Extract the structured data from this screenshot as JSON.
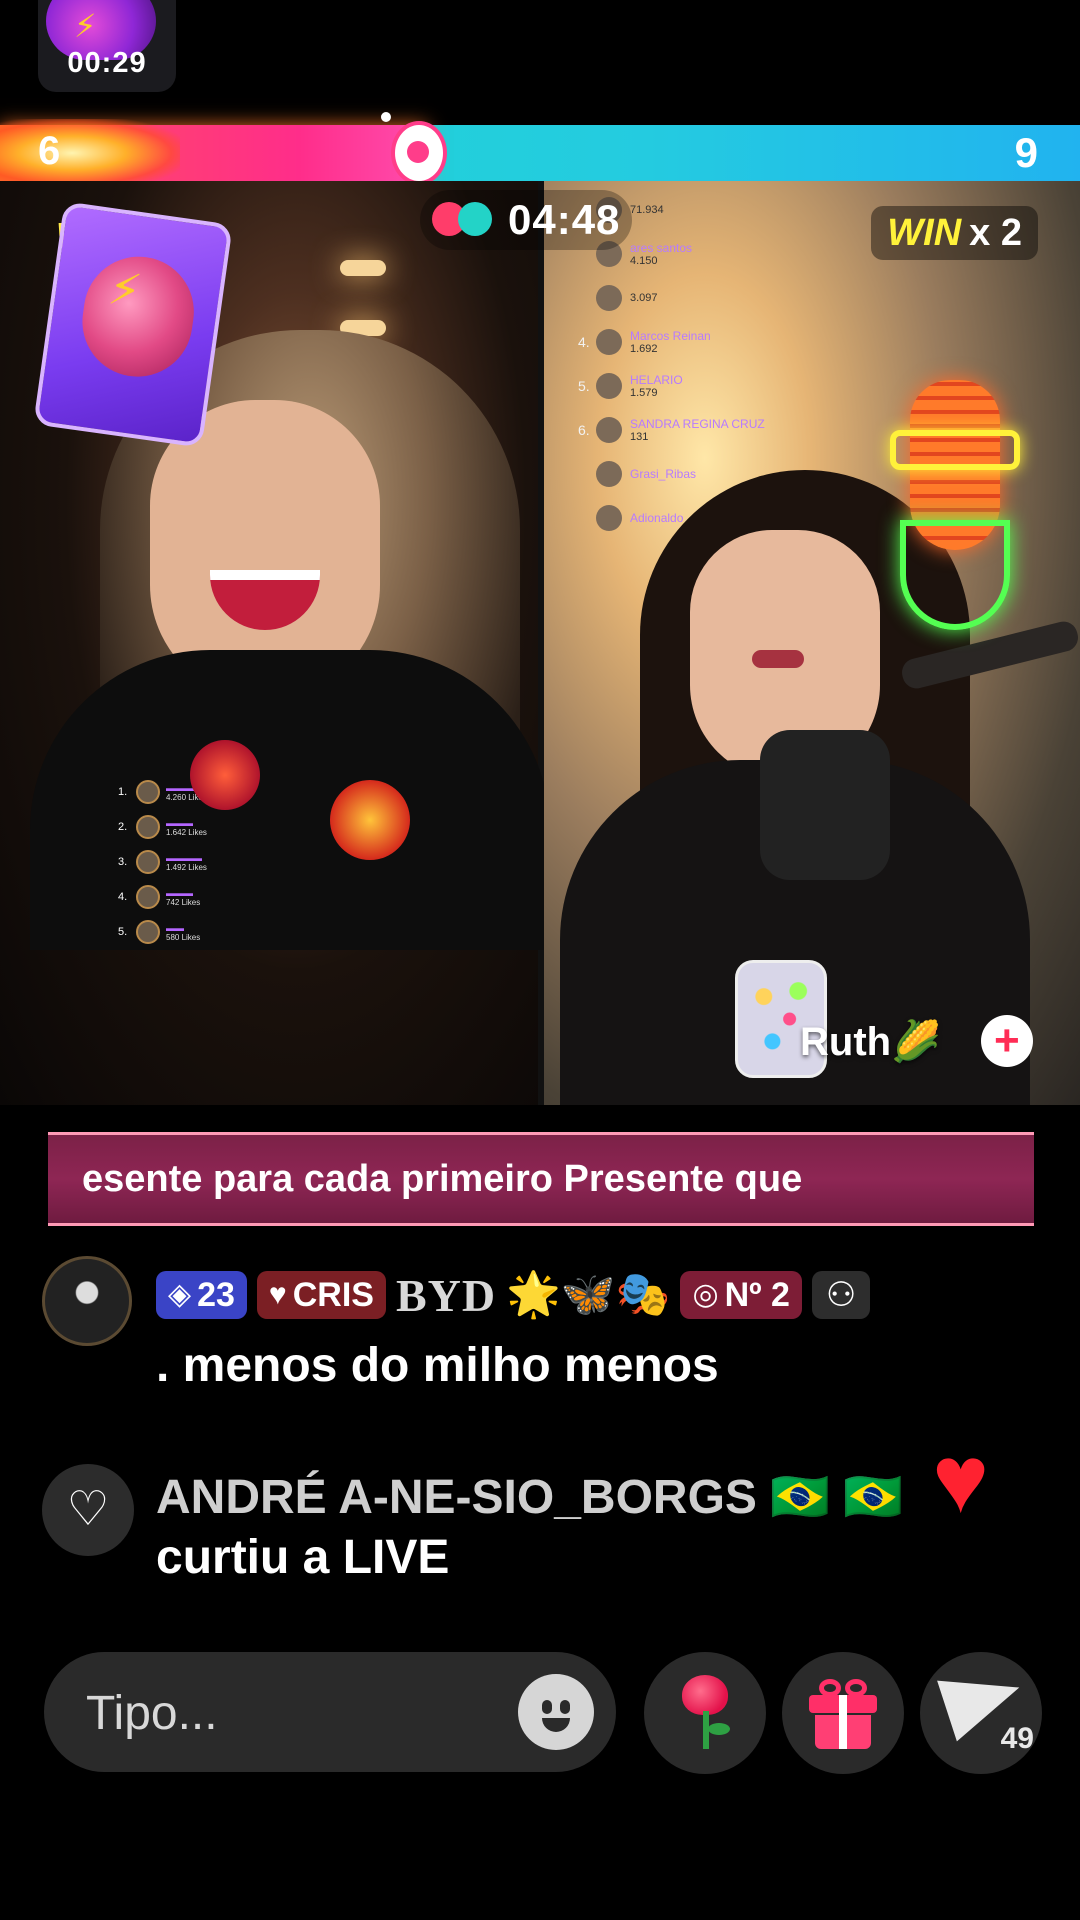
{
  "booster": {
    "timer": "00:29"
  },
  "battle": {
    "score_left": "6",
    "score_right": "9",
    "progress_left_fraction": 0.395,
    "timer": "04:48",
    "win_label": "WIN",
    "win_multiplier": "x 2",
    "left_label_partial": "W"
  },
  "host_right": {
    "name": "Ruth🌽",
    "follow_symbol": "+"
  },
  "mini_leaderboard_left": [
    {
      "rank": "1.",
      "likes": "4.260 Likes"
    },
    {
      "rank": "2.",
      "likes": "1.642 Likes"
    },
    {
      "rank": "3.",
      "likes": "1.492 Likes"
    },
    {
      "rank": "4.",
      "likes": "742 Likes"
    },
    {
      "rank": "5.",
      "likes": "580 Likes"
    }
  ],
  "leaderboard_right": [
    {
      "rank": "",
      "name": "",
      "likes": "71.934"
    },
    {
      "rank": "",
      "name": "ares santos",
      "likes": "4.150"
    },
    {
      "rank": "",
      "name": "",
      "likes": "3.097"
    },
    {
      "rank": "4.",
      "name": "Marcos Reinan",
      "likes": "1.692"
    },
    {
      "rank": "5.",
      "name": "HELARIO",
      "likes": "1.579"
    },
    {
      "rank": "6.",
      "name": "SANDRA REGINA CRUZ",
      "likes": "131"
    },
    {
      "rank": "",
      "name": "Grasi_Ribas",
      "likes": ""
    },
    {
      "rank": "",
      "name": "Adionaldo",
      "likes": ""
    }
  ],
  "banner": {
    "text": "esente para cada primeiro Presente que"
  },
  "comment": {
    "badges": {
      "level": "23",
      "team": "CRIS",
      "rank": "Nº 2"
    },
    "name_art": "BYD",
    "emojis": "🌟🦋🎭",
    "message": ". menos do milho menos"
  },
  "like_event": {
    "user": "ANDRÉ A-NE-SIO_BORGS 🇧🇷 🇧🇷",
    "action": "curtiu a LIVE",
    "heart_icon": "heart-outline-icon"
  },
  "bottom_bar": {
    "input_placeholder": "Tipo...",
    "share_count": "49"
  },
  "colors": {
    "bar_left": "#ff2d8a",
    "bar_right": "#21b3ef",
    "banner_bg": "#8e2654",
    "win_yellow": "#fff23a"
  }
}
